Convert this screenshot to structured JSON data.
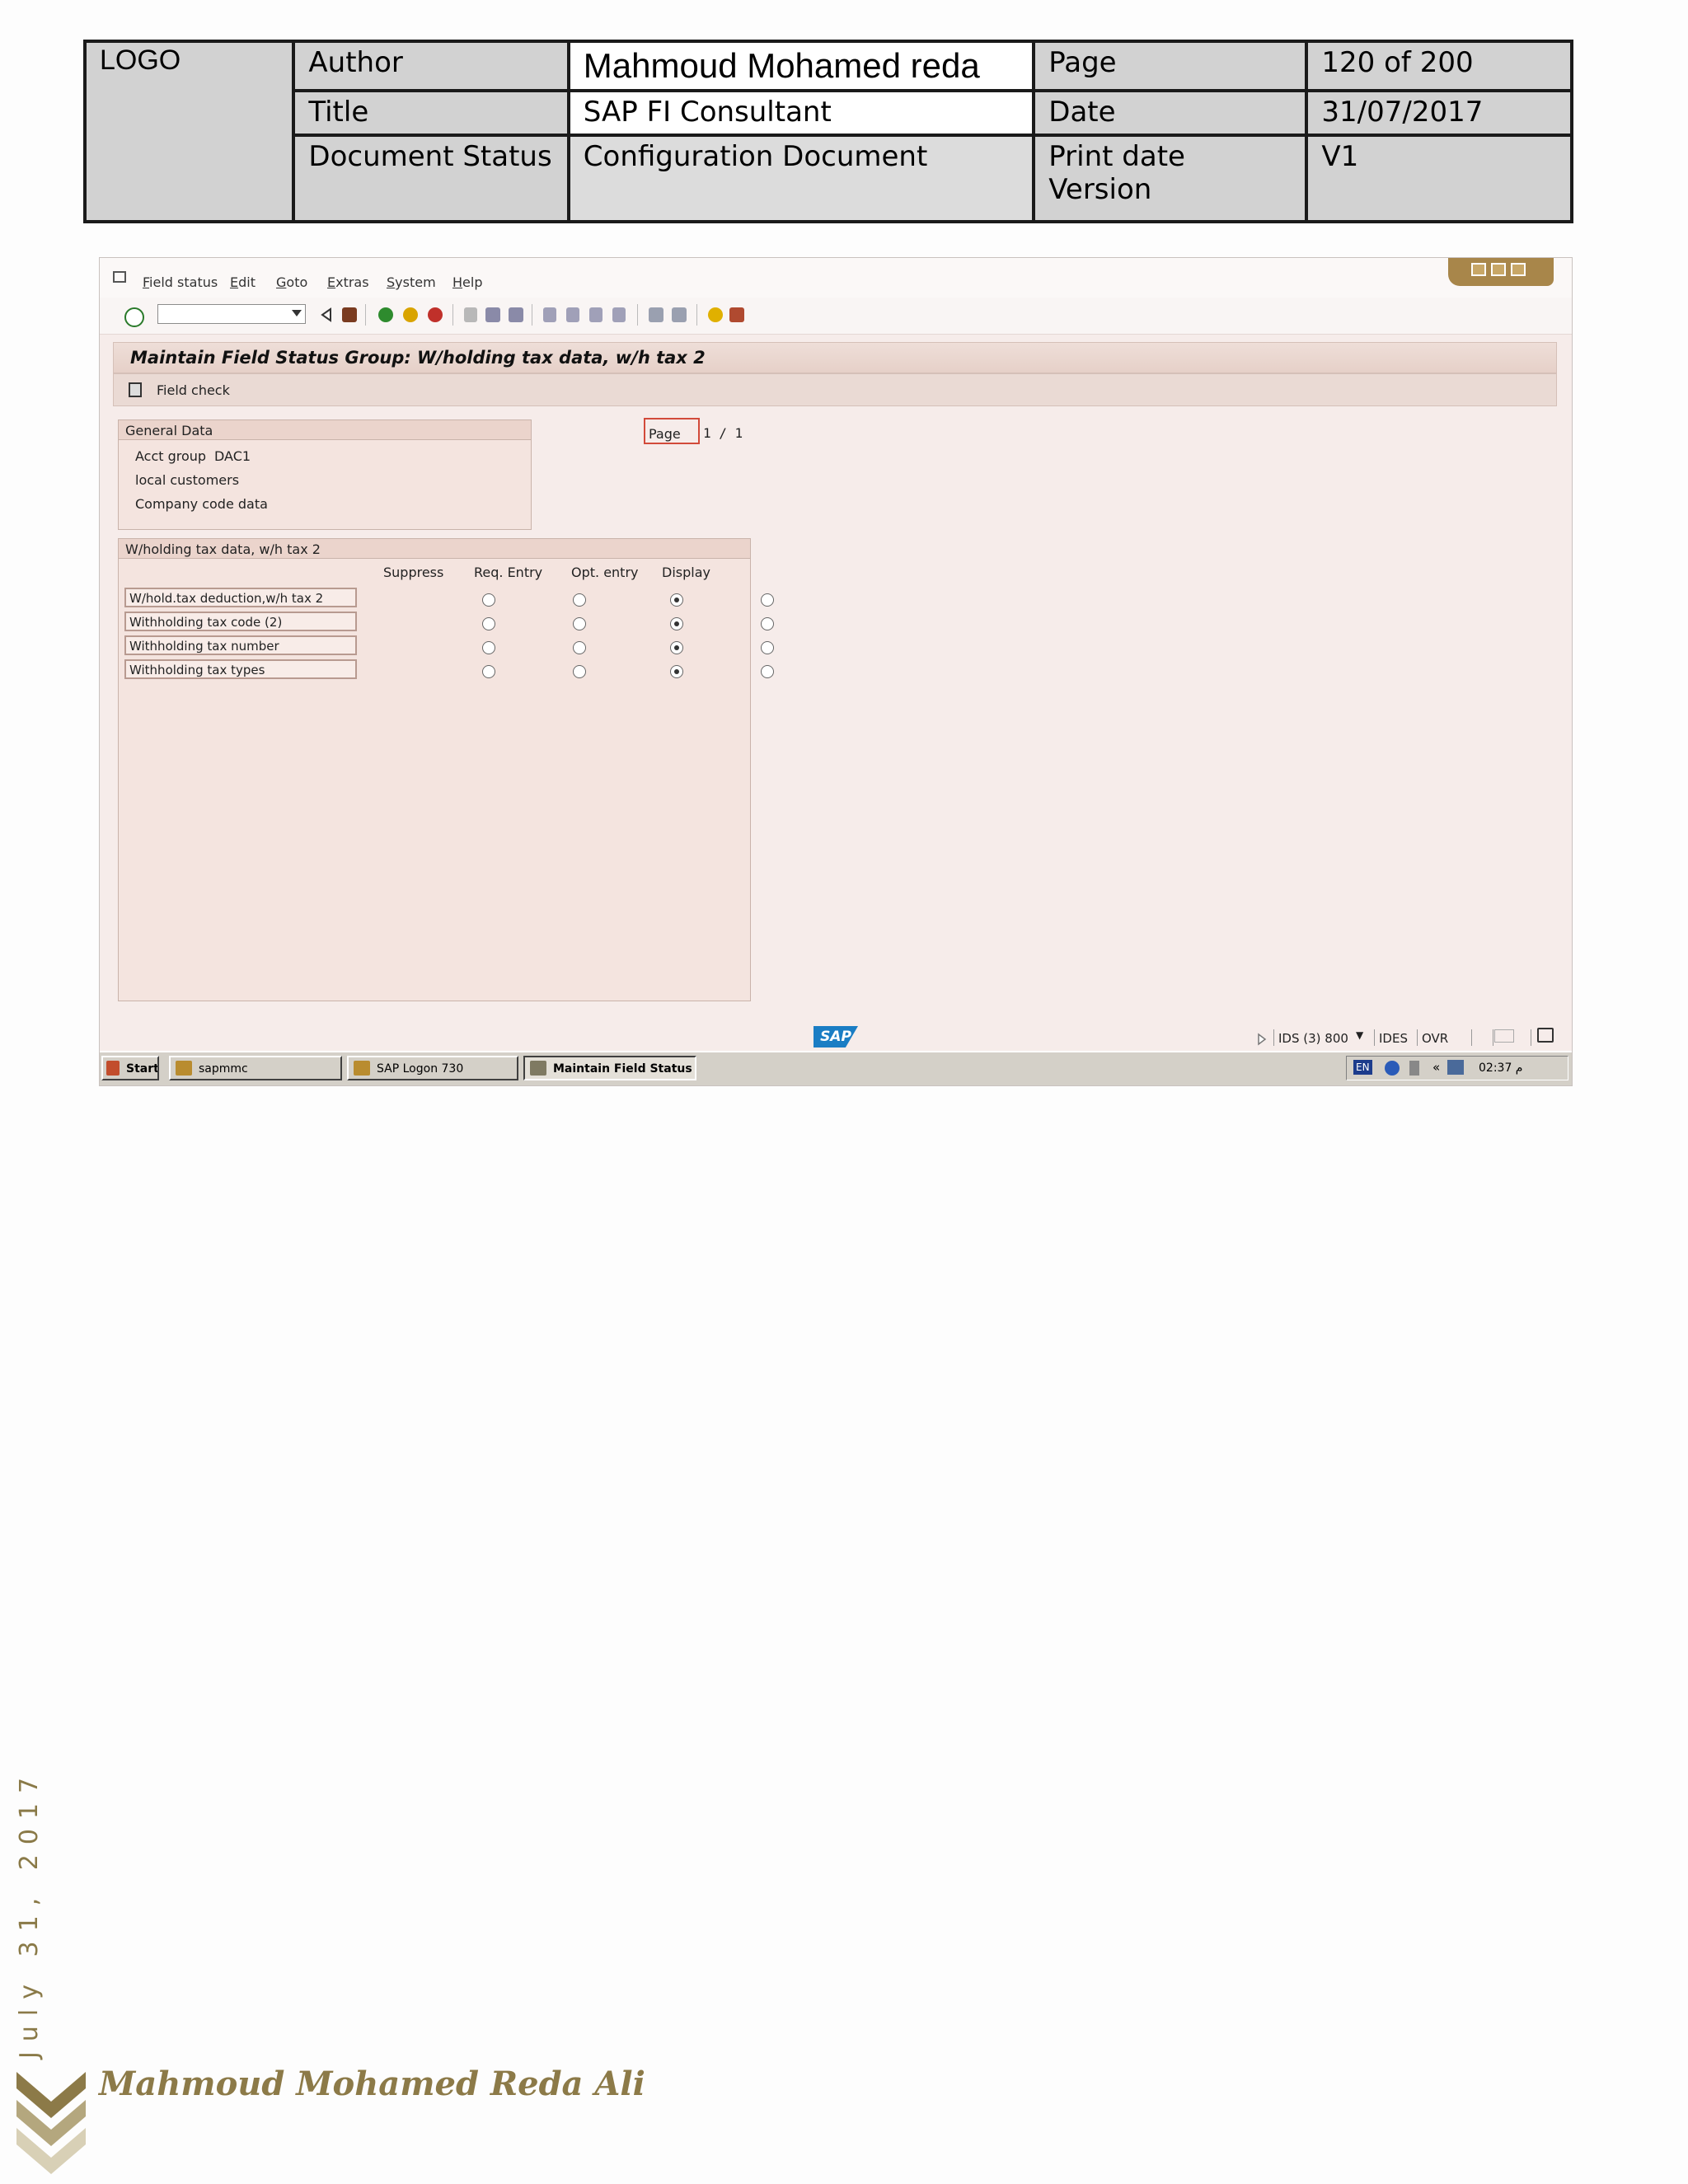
{
  "header": {
    "logo": "LOGO",
    "author_label": "Author",
    "author_value": "Mahmoud Mohamed reda",
    "page_label": "Page",
    "page_value": "120 of 200",
    "title_label": "Title",
    "title_value": "SAP FI Consultant",
    "date_label": "Date",
    "date_value": "31/07/2017",
    "status_label": "Document Status",
    "status_value": "Configuration Document",
    "print_label": "Print date Version",
    "print_value": "V1"
  },
  "sap": {
    "menu": [
      "Field status",
      "Edit",
      "Goto",
      "Extras",
      "System",
      "Help"
    ],
    "screen_title": "Maintain Field Status Group: W/holding tax data, w/h tax 2",
    "app_button": "Field check",
    "general_group": {
      "title": "General Data",
      "acct_group_label": "Acct group",
      "acct_group_value": "DAC1",
      "line2": "local customers",
      "line3": "Company code data"
    },
    "page_label": "Page",
    "page_of": "1 / 1",
    "wh_group": {
      "title": "W/holding tax data, w/h tax 2",
      "columns": [
        "Suppress",
        "Req. Entry",
        "Opt. entry",
        "Display"
      ],
      "rows": [
        {
          "label": "W/hold.tax deduction,w/h tax 2",
          "selected": 2
        },
        {
          "label": "Withholding tax code (2)",
          "selected": 2
        },
        {
          "label": "Withholding tax number",
          "selected": 2
        },
        {
          "label": "Withholding tax types",
          "selected": 2
        }
      ]
    },
    "status": {
      "logo": "SAP",
      "system": "IDS (3) 800",
      "client": "IDES",
      "mode": "OVR"
    },
    "taskbar": {
      "start": "Start",
      "tasks": [
        "sapmmc",
        "SAP Logon 730",
        "Maintain Field Status ..."
      ],
      "lang": "EN",
      "clock": "02:37 م"
    }
  },
  "footer": {
    "date": "July 31, 2017",
    "name": "Mahmoud Mohamed Reda Ali"
  }
}
